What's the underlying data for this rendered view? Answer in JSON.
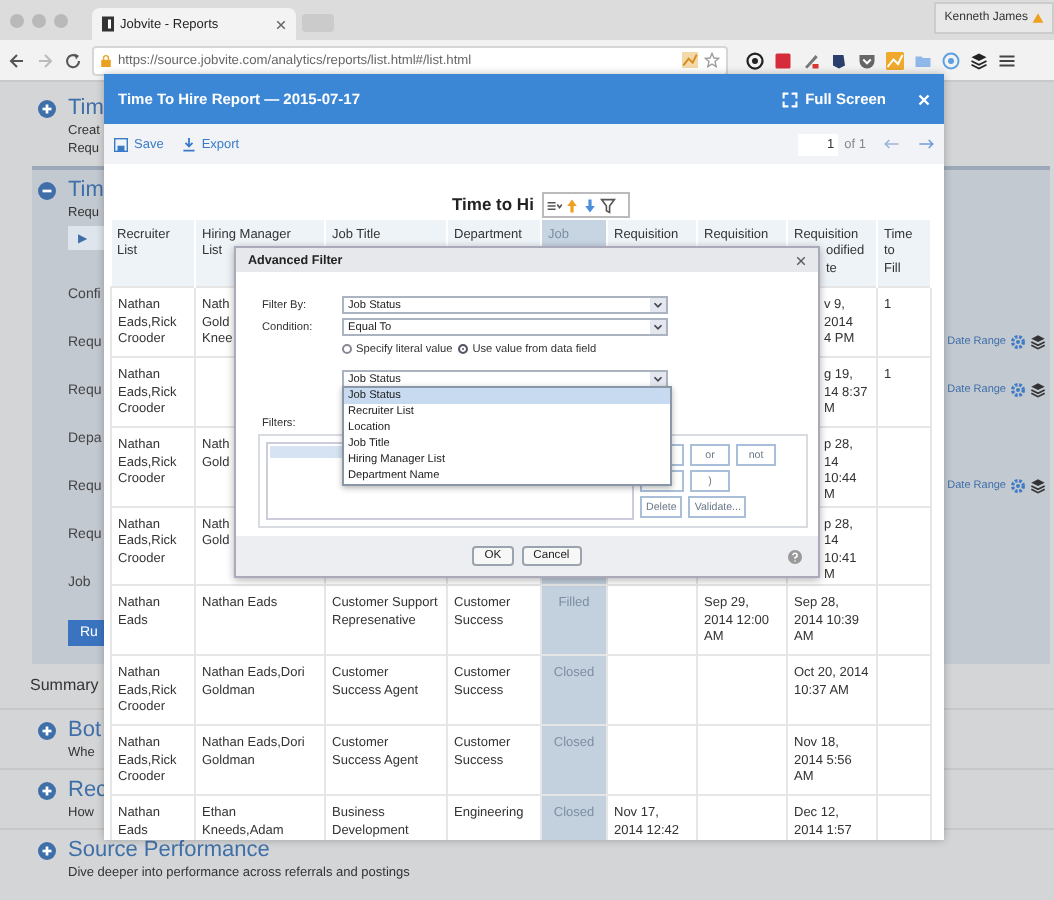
{
  "browser": {
    "tab_title": "Jobvite - Reports",
    "profile": "Kenneth James",
    "url": "https://source.jobvite.com/analytics/reports/list.html#/list.html"
  },
  "page_items": [
    {
      "kind": "section",
      "title": "Tim",
      "expanded": false,
      "lines": [
        "Creat",
        "Requ"
      ]
    },
    {
      "kind": "section",
      "title": "Tim",
      "expanded": true,
      "lines": [
        "Requ"
      ],
      "rows": [
        {
          "kind": "play-button",
          "text": "▶"
        },
        {
          "kind": "label",
          "text": "Confi"
        },
        {
          "kind": "label",
          "text": "Requ",
          "right": "Date Range"
        },
        {
          "kind": "label",
          "text": "Requ",
          "right": "Date Range"
        },
        {
          "kind": "label",
          "text": "Depa"
        },
        {
          "kind": "label",
          "text": "Requ",
          "right": "Date Range"
        },
        {
          "kind": "label",
          "text": "Requ"
        },
        {
          "kind": "label",
          "text": "Job"
        },
        {
          "kind": "run-button",
          "text": "Ru"
        }
      ]
    },
    {
      "kind": "heading",
      "title": "Summary"
    },
    {
      "kind": "section",
      "title": "Bot",
      "expanded": false,
      "lines": [
        "Whe"
      ]
    },
    {
      "kind": "section",
      "title": "Rec",
      "expanded": false,
      "lines": [
        "How"
      ]
    },
    {
      "kind": "section",
      "title": "Source Performance",
      "expanded": false,
      "lines": [
        "Dive deeper into performance across referrals and postings"
      ]
    }
  ],
  "modal": {
    "title": "Time To Hire Report — 2015-07-17",
    "full_screen": "Full Screen",
    "save": "Save",
    "export": "Export",
    "page": "1",
    "page_of": "of 1",
    "report_title": "Time to Hi",
    "columns": [
      {
        "label": "Recruiter\nList",
        "selected": false
      },
      {
        "label": "Hiring Manager\nList",
        "selected": false
      },
      {
        "label": "Job Title",
        "selected": false
      },
      {
        "label": "Department",
        "selected": false
      },
      {
        "label": "Job",
        "selected": true
      },
      {
        "label": "Requisition",
        "selected": false
      },
      {
        "label": "Requisition",
        "selected": false
      },
      {
        "label": "Requisition\nodified\nte",
        "selected": false
      },
      {
        "label": "Time\nto\nFill",
        "selected": false
      }
    ],
    "rows": [
      {
        "recruiter_list": "Nathan Eads,Rick Crooder",
        "hiring_manager_list": "Nath\nGold\nKnee",
        "requisition_modified_date": "v 9, 2014\n4 PM",
        "time_to_fill": "1"
      },
      {
        "recruiter_list": "Nathan Eads,Rick Crooder",
        "requisition_modified_date": "g 19,\n14 8:37\nM",
        "time_to_fill": "1"
      },
      {
        "recruiter_list": "Nathan Eads,Rick Crooder",
        "hiring_manager_list": "Nath\nGold",
        "requisition_modified_date": "p 28,\n14 10:44\nM"
      },
      {
        "recruiter_list": "Nathan Eads,Rick Crooder",
        "hiring_manager_list": "Nath\nGold",
        "requisition_modified_date": "p 28,\n14 10:41\nM"
      },
      {
        "recruiter_list": "Nathan Eads",
        "hiring_manager_list": "Nathan Eads",
        "job_title": "Customer Support Represenative",
        "department": "Customer Success",
        "job": "Filled",
        "requisition_2": "Sep 29, 2014 12:00 AM",
        "requisition_modified_date": "Sep 28, 2014 10:39 AM"
      },
      {
        "recruiter_list": "Nathan Eads,Rick Crooder",
        "hiring_manager_list": "Nathan Eads,Dori Goldman",
        "job_title": "Customer Success Agent",
        "department": "Customer Success",
        "job": "Closed",
        "requisition_modified_date": "Oct 20, 2014 10:37 AM"
      },
      {
        "recruiter_list": "Nathan Eads,Rick Crooder",
        "hiring_manager_list": "Nathan Eads,Dori Goldman",
        "job_title": "Customer Success Agent",
        "department": "Customer Success",
        "job": "Closed",
        "requisition_modified_date": "Nov 18, 2014 5:56 AM"
      },
      {
        "recruiter_list": "Nathan\nEads",
        "hiring_manager_list": "Ethan\nKneeds,Adam",
        "job_title": "Business\nDevelopment",
        "department": "Engineering",
        "job": "Closed",
        "requisition_1": "Nov 17,\n2014 12:42",
        "requisition_modified_date": "Dec 12,\n2014 1:57"
      }
    ]
  },
  "dialog": {
    "title": "Advanced Filter",
    "fields": [
      {
        "label": "Filter By:",
        "value": "Job Status"
      },
      {
        "label": "Condition:",
        "value": "Equal To"
      }
    ],
    "radios": [
      {
        "label": "Specify literal value",
        "selected": false
      },
      {
        "label": "Use value from data field",
        "selected": true
      }
    ],
    "field_select": {
      "value": "Job Status",
      "expanded": true,
      "options": [
        {
          "label": "Job Status",
          "selected": true
        },
        {
          "label": "Recruiter List",
          "selected": false
        },
        {
          "label": "Location",
          "selected": false
        },
        {
          "label": "Job Title",
          "selected": false
        },
        {
          "label": "Hiring Manager List",
          "selected": false
        },
        {
          "label": "Department Name",
          "selected": false
        }
      ]
    },
    "filters_label": "Filters:",
    "filter_button_rows": [
      [
        {
          "kind": "blank"
        },
        {
          "kind": "text",
          "label": "or"
        },
        {
          "kind": "text",
          "label": "not"
        }
      ],
      [
        {
          "kind": "blank"
        },
        {
          "kind": "text",
          "label": ")"
        }
      ],
      [
        {
          "kind": "text",
          "label": "Delete"
        },
        {
          "kind": "text",
          "label": "Validate..."
        }
      ]
    ],
    "ok": "OK",
    "cancel": "Cancel"
  }
}
